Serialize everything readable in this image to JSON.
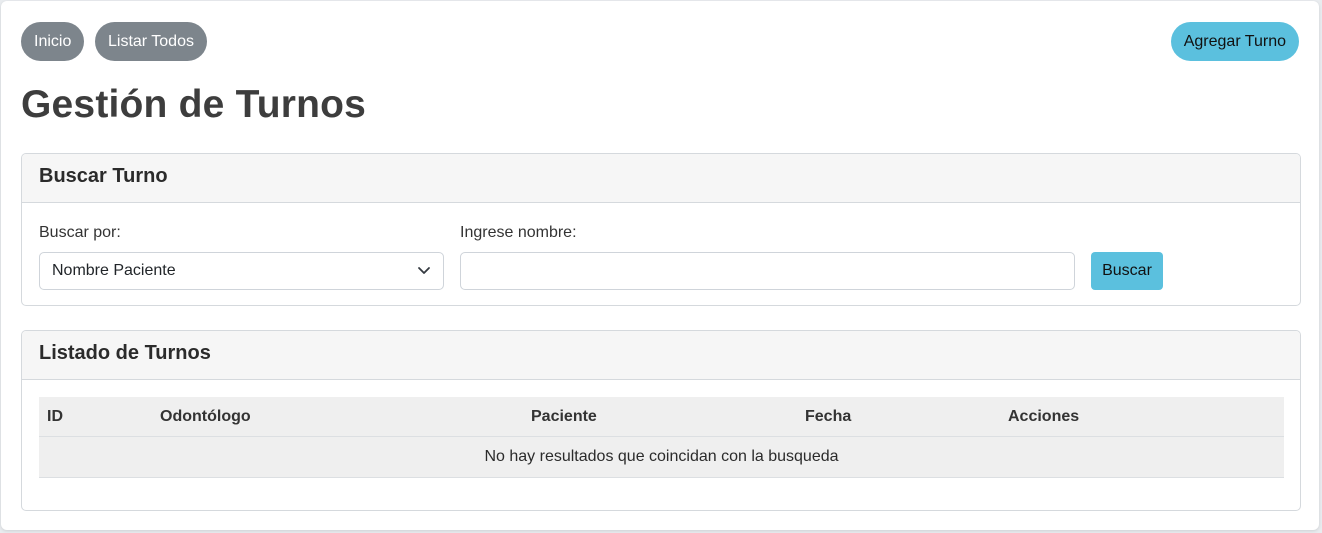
{
  "nav": {
    "inicio": "Inicio",
    "listar_todos": "Listar Todos",
    "agregar_turno": "Agregar Turno"
  },
  "page_title": "Gestión de Turnos",
  "search": {
    "title": "Buscar Turno",
    "by_label": "Buscar por:",
    "by_selected": "Nombre Paciente",
    "name_label": "Ingrese nombre:",
    "name_value": "",
    "name_placeholder": "",
    "button": "Buscar"
  },
  "list": {
    "title": "Listado de Turnos",
    "columns": [
      "ID",
      "Odontólogo",
      "Paciente",
      "Fecha",
      "Acciones"
    ],
    "empty_message": "No hay resultados que coincidan con la busqueda"
  },
  "colors": {
    "gray_button": "#7d858c",
    "info_button": "#5bc0de",
    "card_header": "#f6f6f6"
  }
}
